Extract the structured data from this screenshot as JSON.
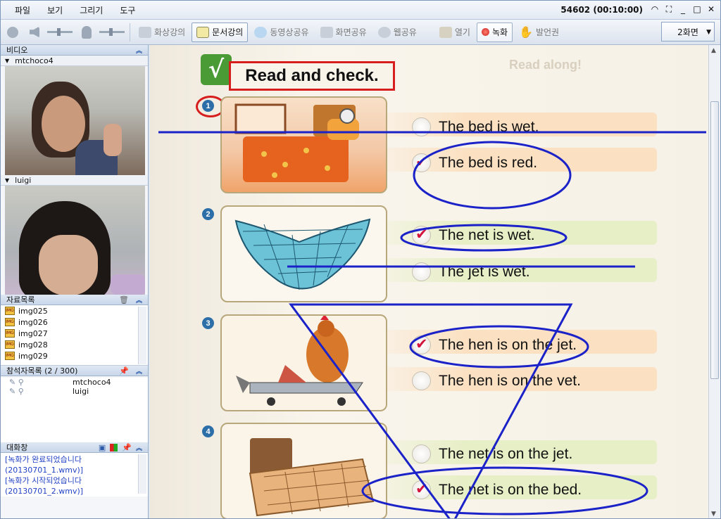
{
  "menubar": {
    "items": [
      "파일",
      "보기",
      "그리기",
      "도구"
    ],
    "session": "54602 (00:10:00)"
  },
  "toolbar": {
    "video_lecture": "화상강의",
    "doc_lecture": "문서강의",
    "video_share": "동영상공유",
    "screen_share": "화면공유",
    "web_share": "웹공유",
    "open": "열기",
    "record": "녹화",
    "speak": "발언권",
    "screens": "2화면"
  },
  "video_panel": {
    "title": "비디오",
    "users": [
      "mtchoco4",
      "luigi"
    ]
  },
  "files_panel": {
    "title": "자료목록",
    "files": [
      "img025",
      "img026",
      "img027",
      "img028",
      "img029"
    ]
  },
  "participants_panel": {
    "title": "참석자목록 (2 / 300)",
    "users": [
      "mtchoco4",
      "luigi"
    ]
  },
  "chat_panel": {
    "title": "대화창",
    "lines": [
      "[녹화가 완료되었습니다",
      "(20130701_1.wmv)]",
      "[녹화가 시작되었습니다",
      "(20130701_2.wmv)]"
    ]
  },
  "document": {
    "heading": "Read and check.",
    "ghost_text": "Read along!",
    "questions": [
      {
        "num": "1",
        "options": [
          "The bed is wet.",
          "The bed is red."
        ],
        "checked": 1
      },
      {
        "num": "2",
        "options": [
          "The net is wet.",
          "The jet is wet."
        ],
        "checked": 0
      },
      {
        "num": "3",
        "options": [
          "The hen is on the jet.",
          "The hen is on the vet."
        ],
        "checked": 0
      },
      {
        "num": "4",
        "options": [
          "The net is on the jet.",
          "The net is on the bed."
        ],
        "checked": 1
      }
    ]
  },
  "colors": {
    "annotation_blue": "#1a22c8",
    "annotation_red": "#d61e1e",
    "check": "#d3143c"
  }
}
